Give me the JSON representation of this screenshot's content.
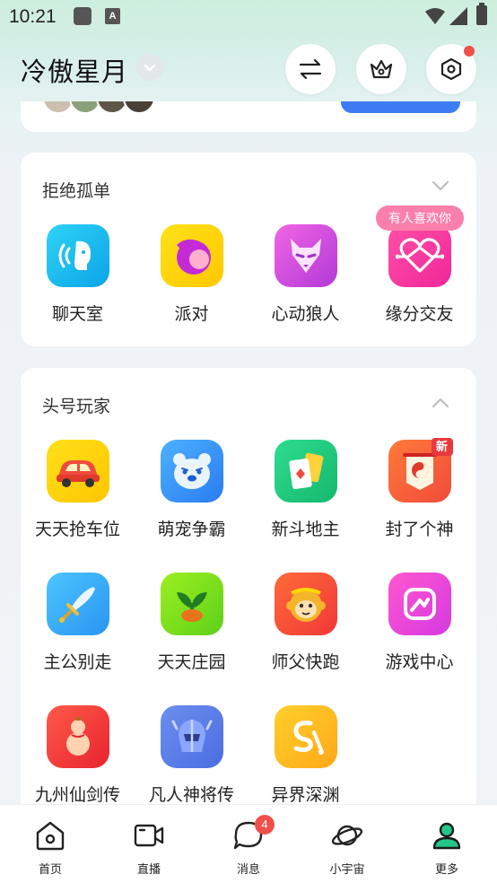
{
  "status_bar": {
    "time": "10:21",
    "notif_letter": "A"
  },
  "header": {
    "username": "冷傲星月"
  },
  "section_lonely": {
    "title": "拒绝孤单",
    "tip": "有人喜欢你",
    "apps": [
      {
        "label": "聊天室",
        "icon": "chat-room-icon"
      },
      {
        "label": "派对",
        "icon": "party-icon"
      },
      {
        "label": "心动狼人",
        "icon": "werewolf-icon"
      },
      {
        "label": "缘分交友",
        "icon": "heart-dating-icon"
      }
    ]
  },
  "section_player": {
    "title": "头号玩家",
    "new_badge": "新",
    "apps": [
      {
        "label": "天天抢车位",
        "icon": "car-icon"
      },
      {
        "label": "萌宠争霸",
        "icon": "bear-icon"
      },
      {
        "label": "新斗地主",
        "icon": "cards-icon"
      },
      {
        "label": "封了个神",
        "icon": "taiji-icon"
      },
      {
        "label": "主公别走",
        "icon": "sword-icon"
      },
      {
        "label": "天天庄园",
        "icon": "sprout-icon"
      },
      {
        "label": "师父快跑",
        "icon": "monkey-icon"
      },
      {
        "label": "游戏中心",
        "icon": "game-center-icon"
      },
      {
        "label": "九州仙剑传",
        "icon": "gourd-icon"
      },
      {
        "label": "凡人神将传",
        "icon": "helmet-icon"
      },
      {
        "label": "异界深渊",
        "icon": "abyss-icon"
      }
    ]
  },
  "bottom_nav": {
    "items": [
      {
        "label": "首页",
        "icon": "home-icon"
      },
      {
        "label": "直播",
        "icon": "video-icon"
      },
      {
        "label": "消息",
        "icon": "message-icon",
        "badge": "4"
      },
      {
        "label": "小宇宙",
        "icon": "planet-icon"
      },
      {
        "label": "更多",
        "icon": "profile-icon",
        "active": true
      }
    ]
  },
  "colors": {
    "accent_blue": "#3d7cf2",
    "badge_red": "#f04f4b",
    "active_green": "#23c58a"
  }
}
